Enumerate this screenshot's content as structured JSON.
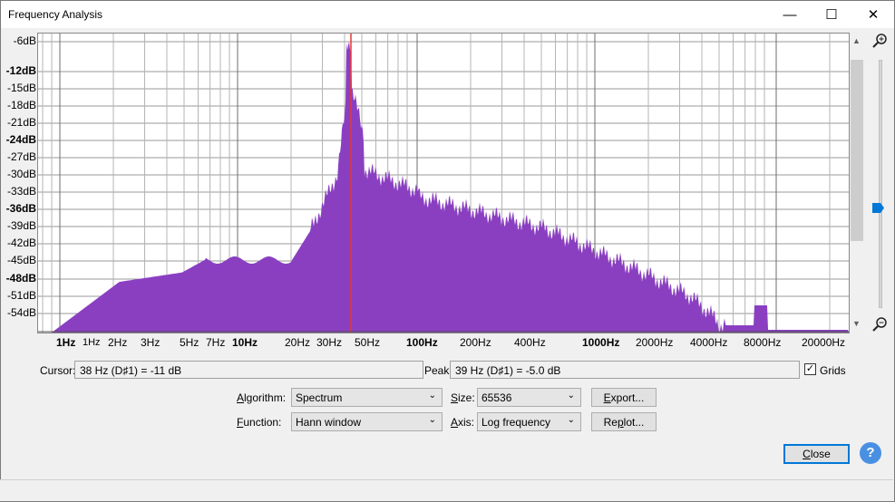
{
  "window": {
    "title": "Frequency Analysis",
    "minimize_icon": "minimize-icon",
    "maximize_icon": "maximize-icon",
    "close_icon": "close-icon"
  },
  "plot": {
    "y_labels": [
      {
        "text": "-6dB",
        "bold": false
      },
      {
        "text": "-12dB",
        "bold": true
      },
      {
        "text": "-15dB",
        "bold": false
      },
      {
        "text": "-18dB",
        "bold": false
      },
      {
        "text": "-21dB",
        "bold": false
      },
      {
        "text": "-24dB",
        "bold": true
      },
      {
        "text": "-27dB",
        "bold": false
      },
      {
        "text": "-30dB",
        "bold": false
      },
      {
        "text": "-33dB",
        "bold": false
      },
      {
        "text": "-36dB",
        "bold": true
      },
      {
        "text": "-39dB",
        "bold": false
      },
      {
        "text": "-42dB",
        "bold": false
      },
      {
        "text": "-45dB",
        "bold": false
      },
      {
        "text": "-48dB",
        "bold": true
      },
      {
        "text": "-51dB",
        "bold": false
      },
      {
        "text": "-54dB",
        "bold": false
      }
    ],
    "x_labels": [
      {
        "text": "1Hz",
        "bold": true
      },
      {
        "text": "1Hz",
        "bold": false,
        "small": true
      },
      {
        "text": "2Hz",
        "bold": false
      },
      {
        "text": "3Hz",
        "bold": false
      },
      {
        "text": "5Hz",
        "bold": false
      },
      {
        "text": "7Hz",
        "bold": false
      },
      {
        "text": "10Hz",
        "bold": true
      },
      {
        "text": "20Hz",
        "bold": false
      },
      {
        "text": "30Hz",
        "bold": false
      },
      {
        "text": "50Hz",
        "bold": false
      },
      {
        "text": "100Hz",
        "bold": true
      },
      {
        "text": "200Hz",
        "bold": false
      },
      {
        "text": "400Hz",
        "bold": false
      },
      {
        "text": "1000Hz",
        "bold": true
      },
      {
        "text": "2000Hz",
        "bold": false
      },
      {
        "text": "4000Hz",
        "bold": false
      },
      {
        "text": "8000Hz",
        "bold": false
      },
      {
        "text": "20000Hz",
        "bold": false
      }
    ],
    "spectrum_color": "#8a3fc1",
    "peak_line_color": "#e53935",
    "zoom_in_icon": "zoom-in-icon",
    "zoom_out_icon": "zoom-out-icon"
  },
  "cursor": {
    "label": "Cursor:",
    "value": "38 Hz (D♯1) = -11 dB"
  },
  "peak": {
    "label": "Peak:",
    "value": "39 Hz (D♯1) = -5.0 dB"
  },
  "grids": {
    "label": "Grids",
    "checked": true
  },
  "algorithm": {
    "label_pre": "",
    "label_ul": "A",
    "label_post": "lgorithm:",
    "value": "Spectrum"
  },
  "function": {
    "label_ul": "F",
    "label_post": "unction:",
    "value": "Hann window"
  },
  "size": {
    "label_ul": "S",
    "label_post": "ize:",
    "value": "65536"
  },
  "axis": {
    "label_ul": "A",
    "label_post": "xis:",
    "value": "Log frequency"
  },
  "buttons": {
    "export_ul": "E",
    "export_post": "xport...",
    "replot_pre": "Re",
    "replot_ul": "p",
    "replot_post": "lot...",
    "close_ul": "C",
    "close_post": "lose",
    "help": "?"
  }
}
